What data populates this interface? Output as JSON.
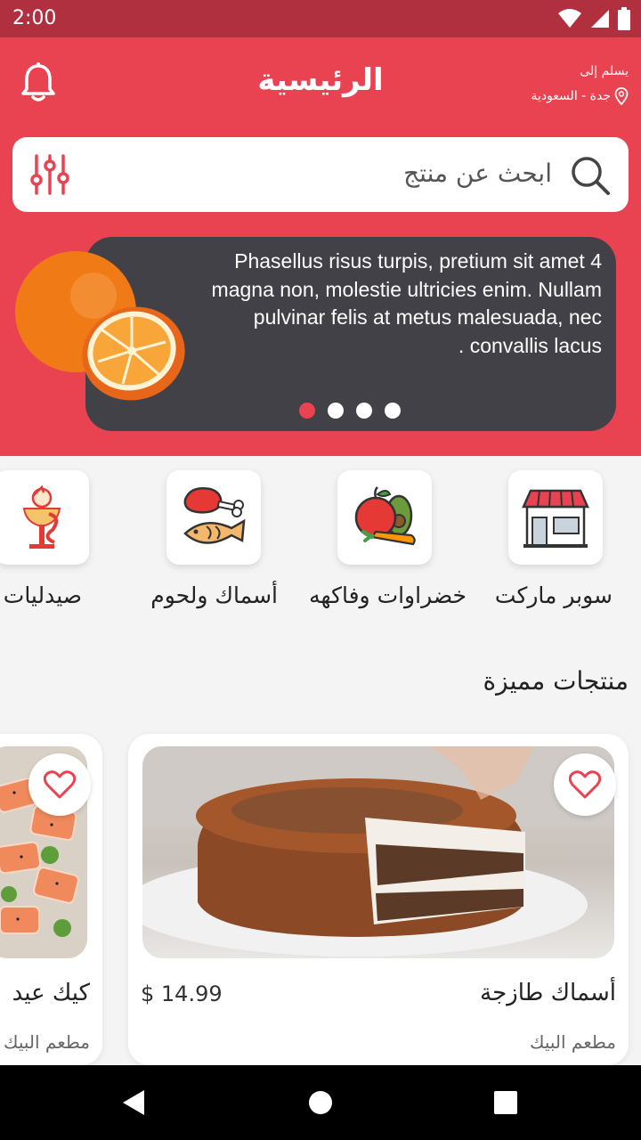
{
  "status_bar": {
    "time": "2:00"
  },
  "header": {
    "title": "الرئيسية",
    "deliver_label": "يسلم إلى",
    "location": "جدة - السعودية"
  },
  "search": {
    "placeholder": "ابحث عن منتج"
  },
  "slider": {
    "text": "Phasellus risus turpis, pretium sit amet 4 magna non, molestie ultricies enim. Nullam pulvinar felis at metus malesuada, nec convallis lacus .",
    "dot_count": 4,
    "active_dot": 1
  },
  "categories": [
    {
      "label": "سوبر ماركت",
      "icon": "store-icon"
    },
    {
      "label": "خضراوات وفاكهه",
      "icon": "fruits-vegetables-icon"
    },
    {
      "label": "أسماك ولحوم",
      "icon": "meat-fish-icon"
    },
    {
      "label": "صيدليات",
      "icon": "pharmacy-icon"
    }
  ],
  "featured": {
    "title": "منتجات مميزة",
    "products": [
      {
        "name": "أسماك طازجة",
        "store": "مطعم البيك",
        "price": "$ 14.99"
      },
      {
        "name": "كيك عيد",
        "store": "مطعم البيك"
      }
    ]
  },
  "colors": {
    "primary": "#e94352",
    "status_bar": "#b03040",
    "slider_bg": "#434148"
  }
}
